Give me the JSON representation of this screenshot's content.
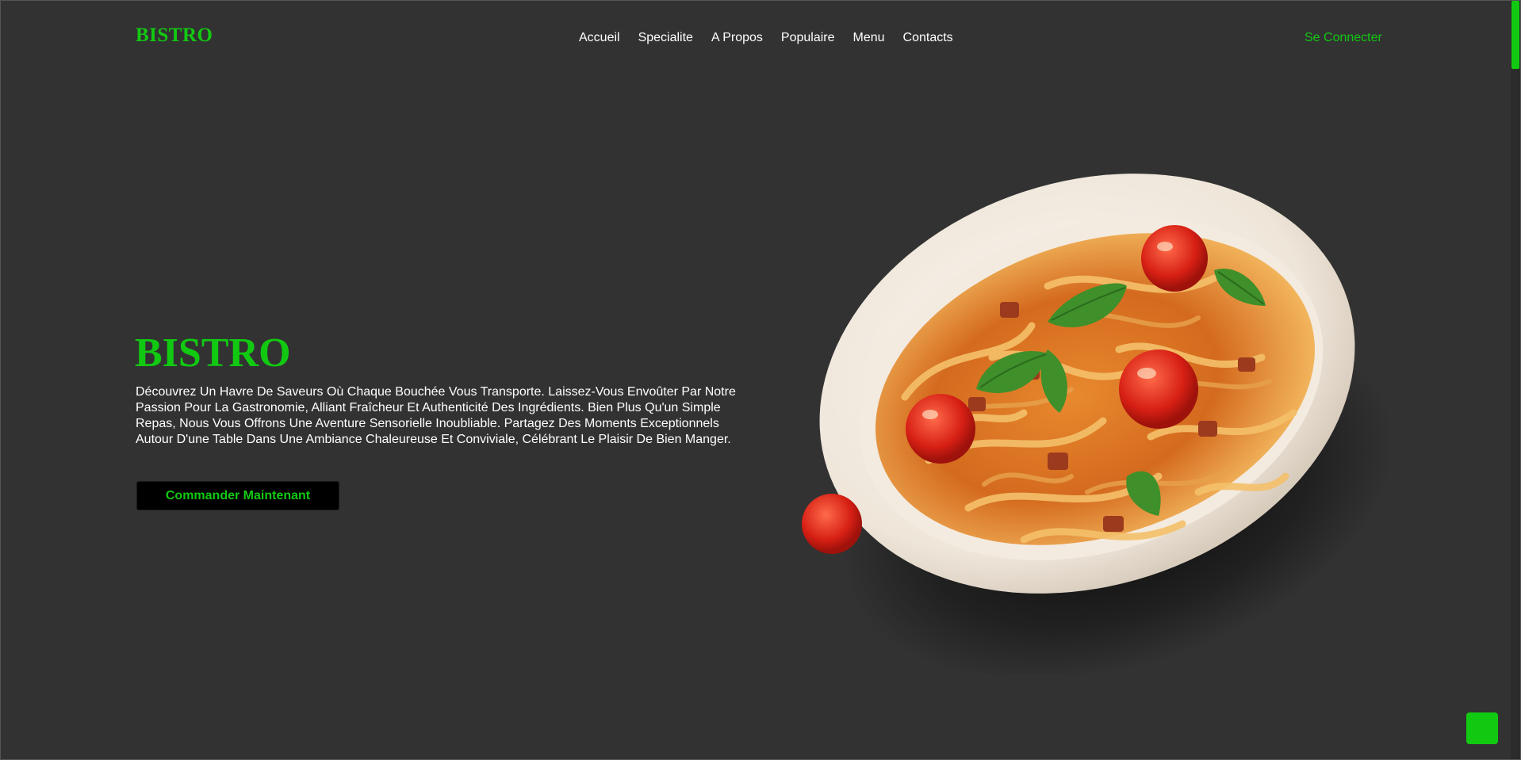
{
  "header": {
    "logo": "BISTRO",
    "nav": [
      {
        "label": "Accueil"
      },
      {
        "label": "Specialite"
      },
      {
        "label": "A Propos"
      },
      {
        "label": "Populaire"
      },
      {
        "label": "Menu"
      },
      {
        "label": "Contacts"
      }
    ],
    "login_label": "Se Connecter"
  },
  "hero": {
    "title": "BISTRO",
    "description": "Découvrez Un Havre De Saveurs Où Chaque Bouchée Vous Transporte. Laissez-Vous Envoûter Par Notre Passion Pour La Gastronomie, Alliant Fraîcheur Et Authenticité Des Ingrédients. Bien Plus Qu'un Simple Repas, Nous Vous Offrons Une Aventure Sensorielle Inoubliable. Partagez Des Moments Exceptionnels Autour D'une Table Dans Une Ambiance Chaleureuse Et Conviviale, Célébrant Le Plaisir De Bien Manger.",
    "cta_label": "Commander Maintenant",
    "image": "pasta-dish-image"
  },
  "colors": {
    "accent": "#12c912",
    "background": "#323232",
    "text": "#ffffff",
    "button_bg": "#000000"
  },
  "icons": {
    "back_to_top": "back-to-top-icon"
  }
}
